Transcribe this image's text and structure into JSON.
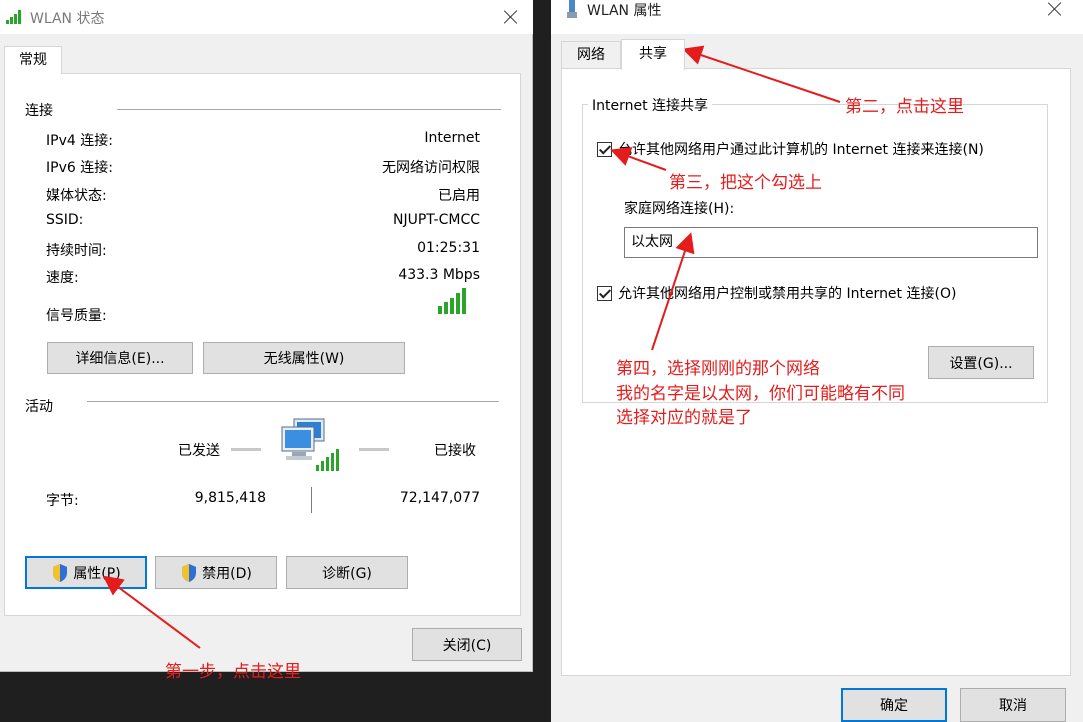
{
  "status_window": {
    "title": "WLAN 状态",
    "tab_general": "常规",
    "connection": {
      "heading": "连接",
      "rows": [
        {
          "label": "IPv4 连接:",
          "value": "Internet"
        },
        {
          "label": "IPv6 连接:",
          "value": "无网络访问权限"
        },
        {
          "label": "媒体状态:",
          "value": "已启用"
        },
        {
          "label": "SSID:",
          "value": "NJUPT-CMCC"
        },
        {
          "label": "持续时间:",
          "value": "01:25:31"
        },
        {
          "label": "速度:",
          "value": "433.3 Mbps"
        }
      ],
      "signal_label": "信号质量:",
      "signal_bars_active": 5,
      "details_button": "详细信息(E)...",
      "wireless_props_button": "无线属性(W)"
    },
    "activity": {
      "heading": "活动",
      "sent_label": "已发送",
      "received_label": "已接收",
      "bytes_label": "字节:",
      "bytes_sent": "9,815,418",
      "bytes_received": "72,147,077"
    },
    "properties_button": "属性(P)",
    "disable_button": "禁用(D)",
    "diagnose_button": "诊断(G)",
    "close_button": "关闭(C)"
  },
  "props_window": {
    "title": "WLAN 属性",
    "tab_network": "网络",
    "tab_sharing": "共享",
    "group_title": "Internet 连接共享",
    "allow_connect_label": "允许其他网络用户通过此计算机的 Internet 连接来连接(N)",
    "home_network_label": "家庭网络连接(H):",
    "home_network_value": "以太网",
    "allow_control_label": "允许其他网络用户控制或禁用共享的 Internet 连接(O)",
    "settings_button": "设置(G)...",
    "ok_button": "确定",
    "cancel_button": "取消"
  },
  "annotations": {
    "step1": "第一步，点击这里",
    "step2": "第二，点击这里",
    "step3": "第三，把这个勾选上",
    "step4_line1": "第四，选择刚刚的那个网络",
    "step4_line2": "我的名字是以太网，你们可能略有不同",
    "step4_line3": "选择对应的就是了"
  },
  "colors": {
    "annotation": "#e51c1c",
    "signal_green": "#2aa52a",
    "focus_blue": "#0078d7"
  }
}
